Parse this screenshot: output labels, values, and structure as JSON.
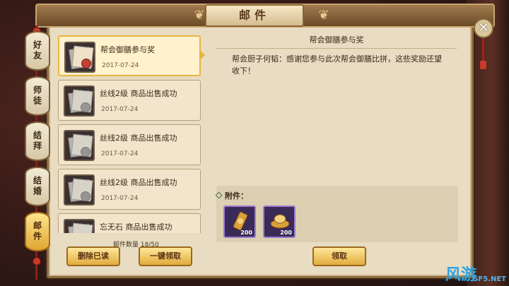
{
  "window": {
    "title": "邮件"
  },
  "tabs": [
    {
      "label": "好友",
      "active": false
    },
    {
      "label": "师徒",
      "active": false
    },
    {
      "label": "结拜",
      "active": false
    },
    {
      "label": "结婚",
      "active": false
    },
    {
      "label": "邮件",
      "active": true
    }
  ],
  "mails": [
    {
      "subject": "帮会御膳参与奖",
      "date": "2017-07-24",
      "icon": "red-seal-letter-icon",
      "selected": true
    },
    {
      "subject": "丝线2级 商品出售成功",
      "date": "2017-07-24",
      "icon": "gray-letter-icon",
      "selected": false
    },
    {
      "subject": "丝线2级 商品出售成功",
      "date": "2017-07-24",
      "icon": "gray-letter-icon",
      "selected": false
    },
    {
      "subject": "丝线2级 商品出售成功",
      "date": "2017-07-24",
      "icon": "gray-letter-icon",
      "selected": false
    },
    {
      "subject": "忘无石 商品出售成功",
      "date": "",
      "icon": "gray-letter-icon",
      "selected": false
    }
  ],
  "mail_count": "邮件数量 18/50",
  "buttons": {
    "delete_read": "删除已读",
    "claim_all": "一键领取",
    "claim": "领取"
  },
  "detail": {
    "title": "帮会御膳参与奖",
    "body": "帮会厨子何韬：感谢您参与此次帮会御膳比拼，这些奖励还望收下！",
    "attachments_label": "附件：",
    "attachments": [
      {
        "icon": "guild-token-icon",
        "count": "200"
      },
      {
        "icon": "gold-ingot-icon",
        "count": "200"
      }
    ]
  },
  "close_icon": "close-icon",
  "watermark": {
    "logo": "风游",
    "site": "SF5.NET"
  },
  "colors": {
    "accent": "#e8b441",
    "panel": "#e8dcc2",
    "active_tab": "#e0a634"
  }
}
